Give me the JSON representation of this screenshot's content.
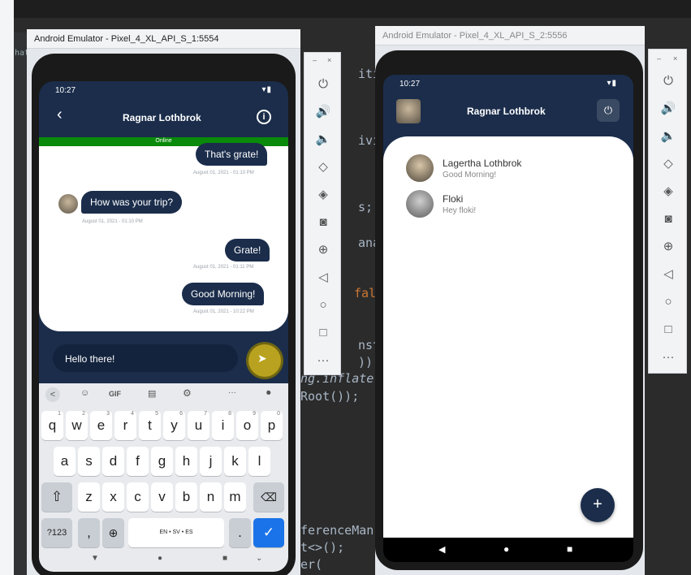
{
  "ide": {
    "code_lines": [
      "itie",
      "ivit",
      "s;",
      "anag",
      "fal",
      "nsta",
      "));",
      "ng.inflate",
      "Root());",
      "ferenceMan",
      "t<>();",
      "er("
    ],
    "gutter_text": "hat"
  },
  "emulator1": {
    "title": "Android Emulator - Pixel_4_XL_API_S_1:5554",
    "status_time": "10:27",
    "chat_title": "Ragnar Lothbrok",
    "online_label": "Online",
    "messages": [
      {
        "text": "That's grate!",
        "time": "August 01, 2021 - 01:10 PM",
        "from": "me"
      },
      {
        "text": "How was your trip?",
        "time": "August 01, 2021 - 01:10 PM",
        "from": "them"
      },
      {
        "text": "Grate!",
        "time": "August 01, 2021 - 01:11 PM",
        "from": "me"
      },
      {
        "text": "Good Morning!",
        "time": "August 01, 2021 - 10:22 PM",
        "from": "me"
      }
    ],
    "input_value": "Hello there!",
    "keyboard": {
      "toolbar": [
        "<",
        "☺",
        "GIF",
        "▤",
        "⚙",
        "···",
        "🎤"
      ],
      "row1": [
        "q",
        "w",
        "e",
        "r",
        "t",
        "y",
        "u",
        "i",
        "o",
        "p"
      ],
      "row1_hints": [
        "1",
        "2",
        "3",
        "4",
        "5",
        "6",
        "7",
        "8",
        "9",
        "0"
      ],
      "row2": [
        "a",
        "s",
        "d",
        "f",
        "g",
        "h",
        "j",
        "k",
        "l"
      ],
      "row3": [
        "z",
        "x",
        "c",
        "v",
        "b",
        "n",
        "m"
      ],
      "mode_key": "?123",
      "comma_key": ",",
      "space_label": "EN • SV • ES",
      "period_key": "."
    }
  },
  "emulator2": {
    "title": "Android Emulator - Pixel_4_XL_API_S_2:5556",
    "status_time": "10:27",
    "app_title": "Ragnar Lothbrok",
    "contacts": [
      {
        "name": "Lagertha Lothbrok",
        "last_message": "Good Morning!"
      },
      {
        "name": "Floki",
        "last_message": "Hey floki!"
      }
    ],
    "fab_label": "+"
  },
  "colors": {
    "navy": "#1b2d4b",
    "online_green": "#0a8a0a",
    "send_button": "#b8a21f",
    "check_key": "#1a73e8"
  }
}
